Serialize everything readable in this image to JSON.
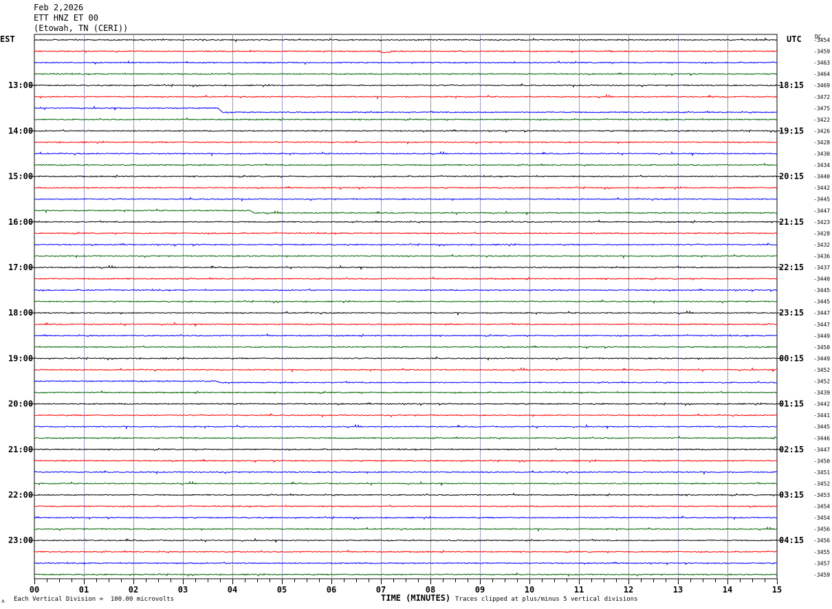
{
  "header": {
    "date": "Feb 2,2026",
    "station": "ETT HNZ ET 00",
    "location": "(Etowah, TN (CERI))"
  },
  "tz_left": "EST",
  "tz_right": "UTC",
  "dc_label": "DC",
  "footer": {
    "left": "Each Vertical Division =  100.00 microvolts",
    "right": "Traces clipped at plus/minus 5 vertical divisions",
    "icon": "ʌ"
  },
  "chart_data": {
    "type": "line",
    "xlabel": "TIME (MINUTES)",
    "xlim": [
      0,
      15
    ],
    "x_ticks": [
      "00",
      "01",
      "02",
      "03",
      "04",
      "05",
      "06",
      "07",
      "08",
      "09",
      "10",
      "11",
      "12",
      "13",
      "14",
      "15"
    ],
    "left_hour_labels": [
      {
        "row": 4,
        "label": "13:00"
      },
      {
        "row": 8,
        "label": "14:00"
      },
      {
        "row": 12,
        "label": "15:00"
      },
      {
        "row": 16,
        "label": "16:00"
      },
      {
        "row": 20,
        "label": "17:00"
      },
      {
        "row": 24,
        "label": "18:00"
      },
      {
        "row": 28,
        "label": "19:00"
      },
      {
        "row": 32,
        "label": "20:00"
      },
      {
        "row": 36,
        "label": "21:00"
      },
      {
        "row": 40,
        "label": "22:00"
      },
      {
        "row": 44,
        "label": "23:00"
      }
    ],
    "right_hour_labels": [
      {
        "row": 4,
        "label": "18:15"
      },
      {
        "row": 8,
        "label": "19:15"
      },
      {
        "row": 12,
        "label": "20:15"
      },
      {
        "row": 16,
        "label": "21:15"
      },
      {
        "row": 20,
        "label": "22:15"
      },
      {
        "row": 24,
        "label": "23:15"
      },
      {
        "row": 28,
        "label": "00:15"
      },
      {
        "row": 32,
        "label": "01:15"
      },
      {
        "row": 36,
        "label": "02:15"
      },
      {
        "row": 40,
        "label": "03:15"
      },
      {
        "row": 44,
        "label": "04:15"
      }
    ],
    "trace_colors": [
      "#000000",
      "#ff0000",
      "#0000ff",
      "#006400"
    ],
    "dc_offsets": [
      "-3454",
      "-3459",
      "-3463",
      "-3464",
      "-3469",
      "-3472",
      "-3475",
      "-3422",
      "-3426",
      "-3428",
      "-3430",
      "-3434",
      "-3440",
      "-3442",
      "-3445",
      "-3447",
      "-3423",
      "-3428",
      "-3432",
      "-3436",
      "-3437",
      "-3440",
      "-3445",
      "-3445",
      "-3447",
      "-3447",
      "-3449",
      "-3450",
      "-3449",
      "-3452",
      "-3452",
      "-3439",
      "-3442",
      "-3441",
      "-3445",
      "-3446",
      "-3447",
      "-3450",
      "-3451",
      "-3452",
      "-3453",
      "-3454",
      "-3454",
      "-3456",
      "-3456",
      "-3455",
      "-3457",
      "-3459"
    ],
    "steps": [
      {
        "row": 1,
        "x": 7.0,
        "offset": 1.5,
        "dur": 0.2
      },
      {
        "row": 6,
        "x": 3.7,
        "offset": 6,
        "ramp": 0.1
      },
      {
        "row": 15,
        "x": 4.35,
        "offset": 3.5,
        "ramp": 0.1
      },
      {
        "row": 30,
        "x": 3.7,
        "offset": 2,
        "ramp": 0.05
      }
    ]
  }
}
